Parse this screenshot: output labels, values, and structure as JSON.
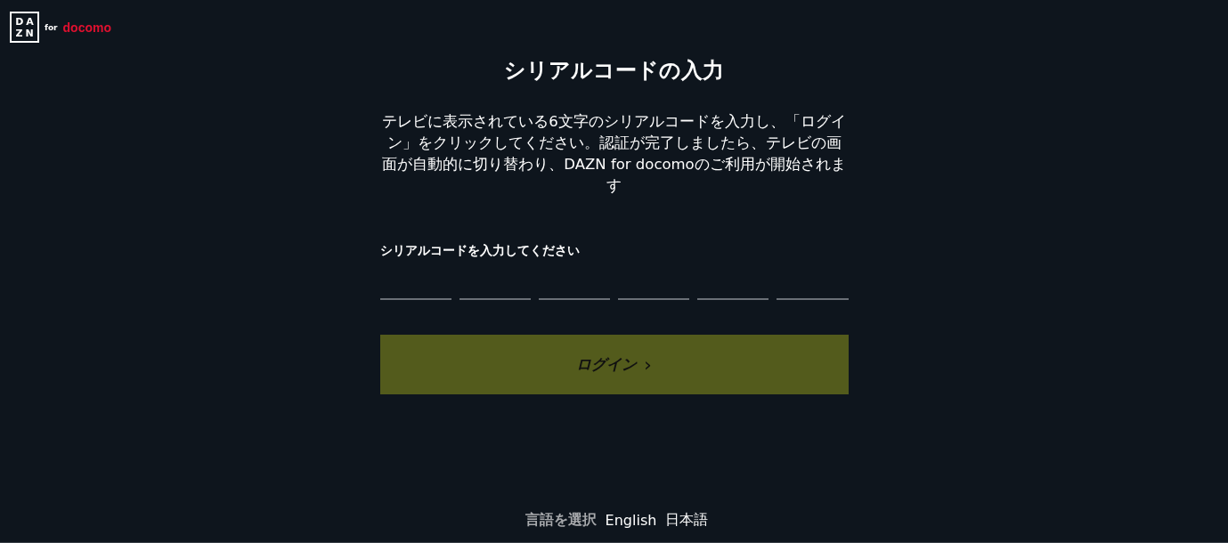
{
  "logo": {
    "mark_letters": [
      "DA",
      "ZN"
    ],
    "for": "for",
    "partner": "docomo"
  },
  "title": "シリアルコードの入力",
  "description": "テレビに表示されている6文字のシリアルコードを入力し、「ログイン」をクリックしてください。認証が完了しましたら、テレビの画面が自動的に切り替わり、DAZN for docomoのご利用が開始されます",
  "code_label": "シリアルコードを入力してください",
  "code_fields": [
    {
      "kind": "digit"
    },
    {
      "kind": "digit"
    },
    {
      "kind": "digit"
    },
    {
      "kind": "digit"
    },
    {
      "kind": "digit"
    },
    {
      "kind": "digit"
    }
  ],
  "login_button": {
    "label": "ログイン",
    "icon": "›",
    "disabled": true
  },
  "footer": {
    "label": "言語を選択",
    "languages": [
      "English",
      "日本語"
    ]
  }
}
